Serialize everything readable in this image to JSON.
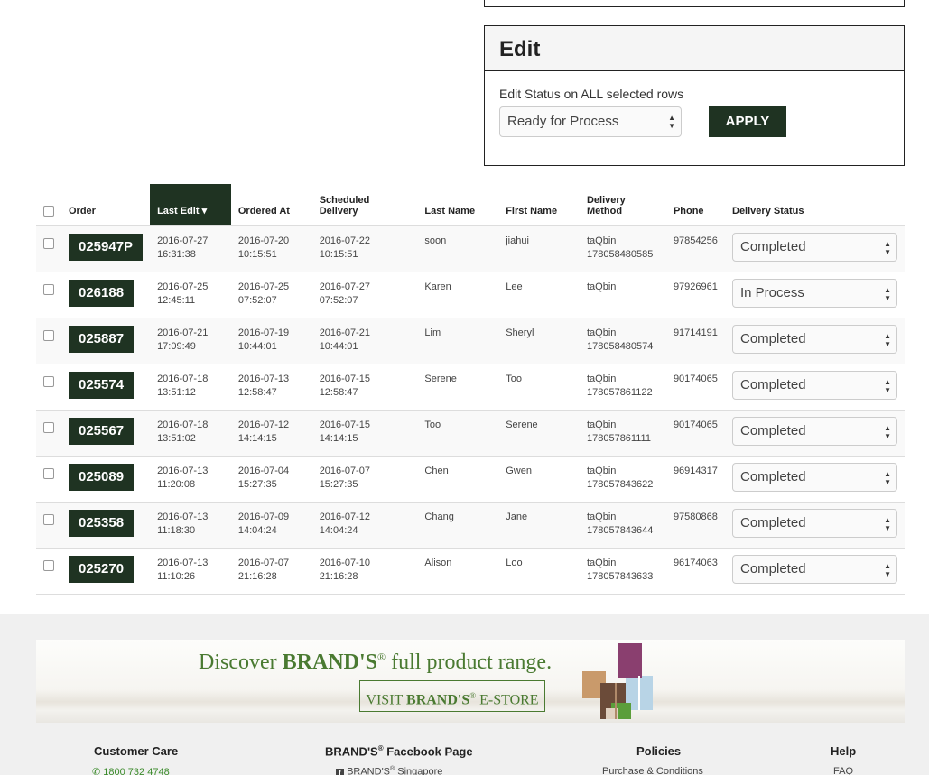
{
  "edit_panel": {
    "title": "Edit",
    "label": "Edit Status on ALL selected rows",
    "selected_status": "Ready for Process",
    "apply_label": "APPLY"
  },
  "table": {
    "headers": {
      "order": "Order",
      "last_edit": "Last Edit",
      "ordered_at": "Ordered At",
      "scheduled_delivery_1": "Scheduled",
      "scheduled_delivery_2": "Delivery",
      "last_name": "Last Name",
      "first_name": "First Name",
      "delivery_method_1": "Delivery",
      "delivery_method_2": "Method",
      "phone": "Phone",
      "delivery_status": "Delivery Status"
    },
    "rows": [
      {
        "order": "025947P",
        "last_edit_date": "2016-07-27",
        "last_edit_time": "16:31:38",
        "ordered_date": "2016-07-20",
        "ordered_time": "10:15:51",
        "sched_date": "2016-07-22",
        "sched_time": "10:15:51",
        "last_name": "soon",
        "first_name": "jiahui",
        "method": "taQbin",
        "tracking": "178058480585",
        "phone": "97854256",
        "status": "Completed"
      },
      {
        "order": "026188",
        "last_edit_date": "2016-07-25",
        "last_edit_time": "12:45:11",
        "ordered_date": "2016-07-25",
        "ordered_time": "07:52:07",
        "sched_date": "2016-07-27",
        "sched_time": "07:52:07",
        "last_name": "Karen",
        "first_name": "Lee",
        "method": "taQbin",
        "tracking": "",
        "phone": "97926961",
        "status": "In Process"
      },
      {
        "order": "025887",
        "last_edit_date": "2016-07-21",
        "last_edit_time": "17:09:49",
        "ordered_date": "2016-07-19",
        "ordered_time": "10:44:01",
        "sched_date": "2016-07-21",
        "sched_time": "10:44:01",
        "last_name": "Lim",
        "first_name": "Sheryl",
        "method": "taQbin",
        "tracking": "178058480574",
        "phone": "91714191",
        "status": "Completed"
      },
      {
        "order": "025574",
        "last_edit_date": "2016-07-18",
        "last_edit_time": "13:51:12",
        "ordered_date": "2016-07-13",
        "ordered_time": "12:58:47",
        "sched_date": "2016-07-15",
        "sched_time": "12:58:47",
        "last_name": "Serene",
        "first_name": "Too",
        "method": "taQbin",
        "tracking": "178057861122",
        "phone": "90174065",
        "status": "Completed"
      },
      {
        "order": "025567",
        "last_edit_date": "2016-07-18",
        "last_edit_time": "13:51:02",
        "ordered_date": "2016-07-12",
        "ordered_time": "14:14:15",
        "sched_date": "2016-07-15",
        "sched_time": "14:14:15",
        "last_name": "Too",
        "first_name": "Serene",
        "method": "taQbin",
        "tracking": "178057861111",
        "phone": "90174065",
        "status": "Completed"
      },
      {
        "order": "025089",
        "last_edit_date": "2016-07-13",
        "last_edit_time": "11:20:08",
        "ordered_date": "2016-07-04",
        "ordered_time": "15:27:35",
        "sched_date": "2016-07-07",
        "sched_time": "15:27:35",
        "last_name": "Chen",
        "first_name": "Gwen",
        "method": "taQbin",
        "tracking": "178057843622",
        "phone": "96914317",
        "status": "Completed"
      },
      {
        "order": "025358",
        "last_edit_date": "2016-07-13",
        "last_edit_time": "11:18:30",
        "ordered_date": "2016-07-09",
        "ordered_time": "14:04:24",
        "sched_date": "2016-07-12",
        "sched_time": "14:04:24",
        "last_name": "Chang",
        "first_name": "Jane",
        "method": "taQbin",
        "tracking": "178057843644",
        "phone": "97580868",
        "status": "Completed"
      },
      {
        "order": "025270",
        "last_edit_date": "2016-07-13",
        "last_edit_time": "11:10:26",
        "ordered_date": "2016-07-07",
        "ordered_time": "21:16:28",
        "sched_date": "2016-07-10",
        "sched_time": "21:16:28",
        "last_name": "Alison",
        "first_name": "Loo",
        "method": "taQbin",
        "tracking": "178057843633",
        "phone": "96174063",
        "status": "Completed"
      }
    ]
  },
  "banner": {
    "headline_pre": "Discover ",
    "headline_brand": "BRAND'S",
    "headline_reg": "®",
    "headline_post": " full product range.",
    "button_pre": "VISIT ",
    "button_brand": "BRAND'S",
    "button_reg": "®",
    "button_post": " E-STORE"
  },
  "footer": {
    "customer_care": "Customer Care",
    "customer_care_phone": "1800 732 4748",
    "facebook_title_pre": "BRAND'S",
    "facebook_title_reg": "®",
    "facebook_title_post": " Facebook Page",
    "facebook_link_pre": "BRAND'S",
    "facebook_link_reg": "®",
    "facebook_link_post": " Singapore",
    "policies": "Policies",
    "policies_link": "Purchase & Conditions",
    "help": "Help",
    "help_link": "FAQ"
  },
  "colors": {
    "accent": "#1f3322",
    "brand_green": "#4a7a31"
  },
  "icons": {
    "sort": "caret-down-icon",
    "select": "select-arrows-icon",
    "phone": "phone-icon",
    "facebook": "facebook-icon"
  }
}
